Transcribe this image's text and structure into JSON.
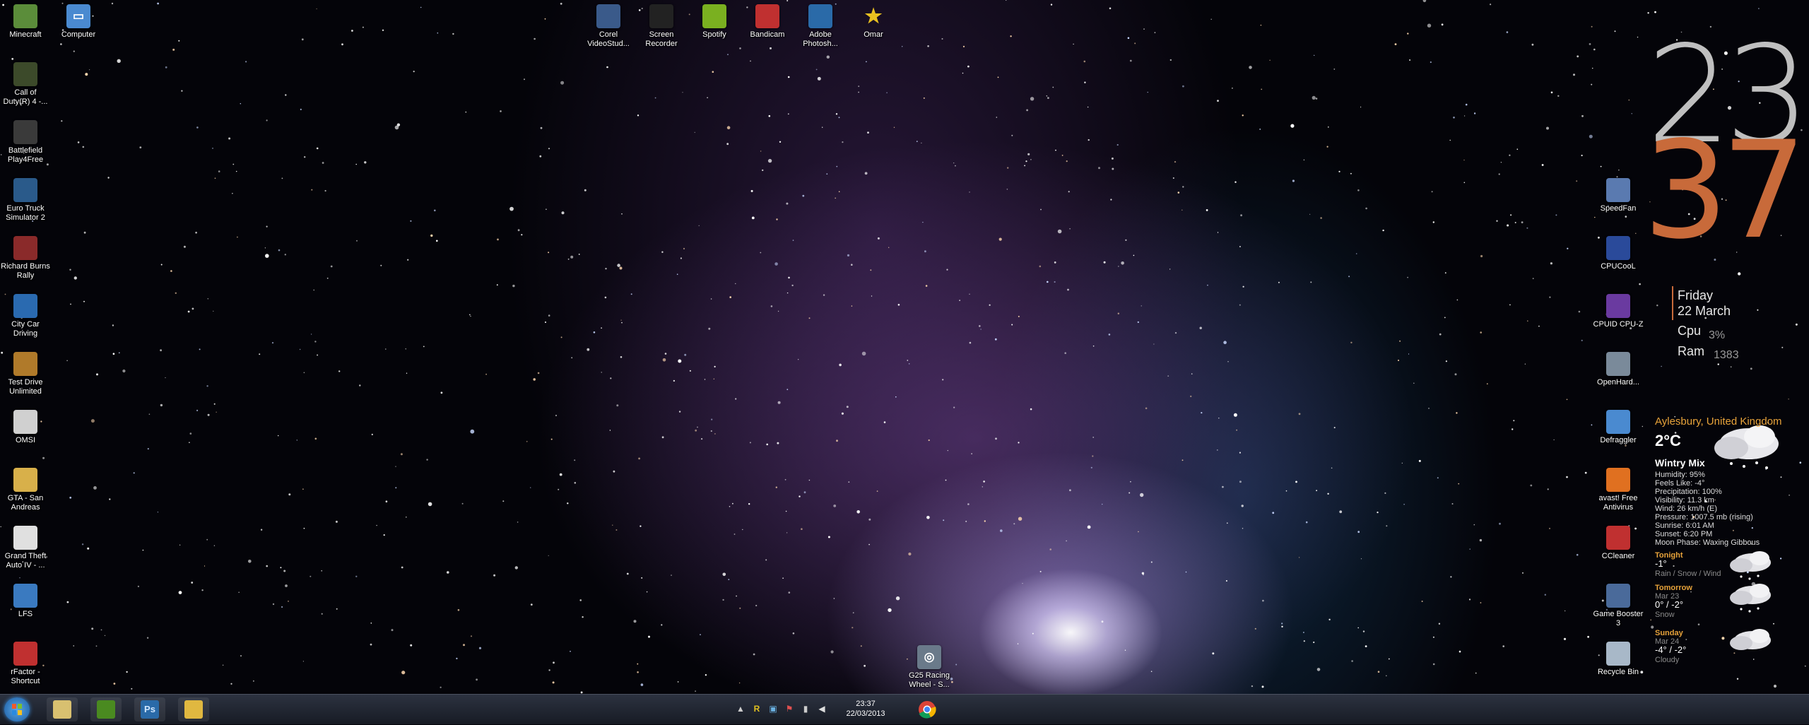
{
  "desktop_icons": {
    "left": [
      {
        "label": "Minecraft",
        "icon": "minecraft-icon",
        "color": "#5b8d3a"
      },
      {
        "label": "Call of Duty(R) 4 -...",
        "icon": "call-of-duty-icon",
        "color": "#3c4a2a"
      },
      {
        "label": "Battlefield Play4Free",
        "icon": "battlefield-icon",
        "color": "#3a3a3a"
      },
      {
        "label": "Euro Truck Simulator 2",
        "icon": "euro-truck-icon",
        "color": "#2a5a8a"
      },
      {
        "label": "Richard Burns Rally",
        "icon": "richard-burns-icon",
        "color": "#8a2a2a"
      },
      {
        "label": "City Car Driving",
        "icon": "city-car-icon",
        "color": "#2a6ab0"
      },
      {
        "label": "Test Drive Unlimited",
        "icon": "test-drive-icon",
        "color": "#b07a2a"
      },
      {
        "label": "OMSI",
        "icon": "omsi-icon",
        "color": "#d0d0d0"
      },
      {
        "label": "GTA - San Andreas",
        "icon": "gta-sa-folder-icon",
        "color": "#d8b04a"
      },
      {
        "label": "Grand Theft Auto IV - ...",
        "icon": "gta-iv-icon",
        "color": "#e0e0e0"
      },
      {
        "label": "LFS",
        "icon": "lfs-icon",
        "color": "#3a7ac0"
      },
      {
        "label": "rFactor - Shortcut",
        "icon": "rfactor-icon",
        "color": "#c03030"
      }
    ],
    "computer": {
      "label": "Computer",
      "icon": "computer-icon",
      "color": "#4a8ad0"
    },
    "top": [
      {
        "label": "Corel VideoStud...",
        "icon": "corel-icon",
        "color": "#3a5a8a"
      },
      {
        "label": "Screen Recorder",
        "icon": "screen-recorder-icon",
        "color": "#222222"
      },
      {
        "label": "Spotify",
        "icon": "spotify-icon",
        "color": "#7ab020"
      },
      {
        "label": "Bandicam",
        "icon": "bandicam-icon",
        "color": "#c03030"
      },
      {
        "label": "Adobe Photosh...",
        "icon": "photoshop-icon",
        "color": "#2a6aa8"
      },
      {
        "label": "Omar",
        "icon": "star-icon",
        "color": "#e8c020"
      }
    ],
    "right": [
      {
        "label": "SpeedFan",
        "icon": "speedfan-icon",
        "color": "#5a7ab0"
      },
      {
        "label": "CPUCooL",
        "icon": "cpucool-icon",
        "color": "#2a4a9a"
      },
      {
        "label": "CPUID CPU-Z",
        "icon": "cpuz-icon",
        "color": "#6a3aa0"
      },
      {
        "label": "OpenHard...",
        "icon": "openhardware-icon",
        "color": "#7a8a9a"
      },
      {
        "label": "Defraggler",
        "icon": "defraggler-icon",
        "color": "#4a8ad0"
      },
      {
        "label": "avast! Free Antivirus",
        "icon": "avast-icon",
        "color": "#e07020"
      },
      {
        "label": "CCleaner",
        "icon": "ccleaner-icon",
        "color": "#c03030"
      },
      {
        "label": "Game Booster 3",
        "icon": "game-booster-icon",
        "color": "#4a6a9a"
      },
      {
        "label": "Recycle Bin",
        "icon": "recycle-bin-icon",
        "color": "#a8b8c8"
      }
    ],
    "bottom": {
      "label": "G25 Racing Wheel - S...",
      "icon": "g25-racing-icon",
      "color": "#6a7a8a"
    }
  },
  "clock_widget": {
    "hour": "23",
    "minute": "37",
    "day": "Friday",
    "date": "22 March",
    "cpu_label": "Cpu",
    "cpu_value": "3%",
    "ram_label": "Ram",
    "ram_value": "1383",
    "hour_color": "#bfbfbf",
    "minute_color": "#c86a3a"
  },
  "weather_widget": {
    "location": "Aylesbury, United Kingdom",
    "temp": "2°C",
    "condition": "Wintry Mix",
    "details": [
      "Humidity: 95%",
      "Feels Like: -4°",
      "Precipitation: 100%",
      "Visibility: 11.3 km",
      "Wind: 26 km/h (E)",
      "Pressure: 1007.5 mb (rising)",
      "Sunrise: 6:01 AM",
      "Sunset: 6:20 PM",
      "Moon Phase: Waxing Gibbous"
    ],
    "forecast": [
      {
        "title": "Tonight",
        "date": "",
        "temps": "-1°",
        "desc": "Rain / Snow / Wind"
      },
      {
        "title": "Tomorrow",
        "date": "Mar 23",
        "temps": "0° / -2°",
        "desc": "Snow"
      },
      {
        "title": "Sunday",
        "date": "Mar 24",
        "temps": "-4° / -2°",
        "desc": "Cloudy"
      }
    ],
    "accent_color": "#e8a33a"
  },
  "taskbar": {
    "start_icon": "windows-start-icon",
    "pinned": [
      {
        "icon": "paint-icon",
        "color": "#d8c070"
      },
      {
        "icon": "razer-icon",
        "color": "#4a8a20"
      },
      {
        "icon": "photoshop-taskbar-icon",
        "color": "#2a6aa8",
        "text": "Ps"
      },
      {
        "icon": "explorer-folder-icon",
        "color": "#e0b840"
      }
    ],
    "tray_icons": [
      "show-hidden-icons-icon",
      "rivatuner-icon",
      "network-icon",
      "action-center-icon",
      "signal-icon",
      "volume-icon"
    ],
    "time": "23:37",
    "date": "22/03/2013",
    "chrome_icon": "chrome-icon"
  }
}
